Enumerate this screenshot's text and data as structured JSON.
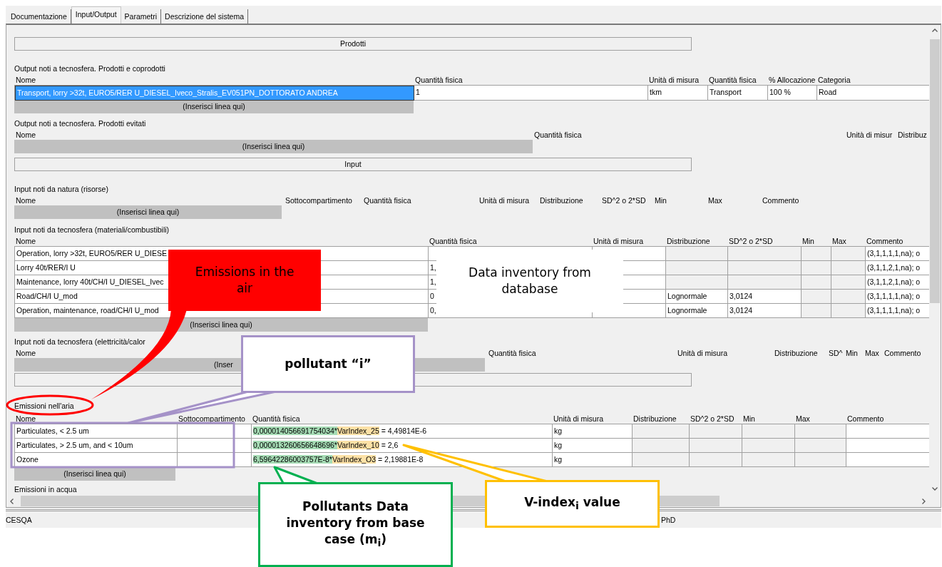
{
  "tabs": [
    {
      "label": "Documentazione",
      "selected": false
    },
    {
      "label": "Input/Output",
      "selected": true
    },
    {
      "label": "Parametri",
      "selected": false
    },
    {
      "label": "Descrizione del sistema",
      "selected": false
    }
  ],
  "sections": [
    {
      "kind": "bar",
      "label": "Prodotti"
    },
    {
      "kind": "table",
      "title": "Output noti a tecnosfera. Prodotti e coprodotti",
      "columns": [
        "Nome",
        "Quantità fisica",
        "Unità di misura",
        "Quantità fisica",
        "% Allocazione",
        "Categoria"
      ],
      "rows": [
        {
          "selected": true,
          "cells": [
            {
              "text": "Transport, lorry >32t, EURO5/RER U_DIESEL_Iveco_Stralis_EV051PN_DOTTORATO ANDREA",
              "disabled": false
            },
            {
              "text": "1",
              "disabled": false
            },
            {
              "text": "tkm",
              "disabled": false
            },
            {
              "text": "Transport",
              "disabled": false
            },
            {
              "text": "100 %",
              "disabled": false
            },
            {
              "text": "Road",
              "disabled": false
            }
          ]
        }
      ],
      "insert": "(Inserisci linea qui)"
    },
    {
      "kind": "table",
      "title": "Output noti a tecnosfera. Prodotti evitati",
      "columns": [
        "Nome",
        "Quantità fisica",
        "Unità di misur",
        "Distribuz"
      ],
      "insert": "(Inserisci linea qui)"
    },
    {
      "kind": "bar",
      "label": "Input"
    },
    {
      "kind": "table",
      "title": "Input noti da natura (risorse)",
      "columns": [
        "Nome",
        "Sottocompartimento",
        "Quantità fisica",
        "Unità di misura",
        "Distribuzione",
        "SD^2 o 2*SD",
        "Min",
        "Max",
        "Commento"
      ],
      "insert": "(Inserisci linea qui)"
    },
    {
      "kind": "table",
      "title": "Input noti da tecnosfera (materiali/combustibili)",
      "columns": [
        "Nome",
        "Quantità fisica",
        "Unità di misura",
        "Distribuzione",
        "SD^2 o 2*SD",
        "Min",
        "Max",
        "Commento"
      ],
      "rows": [
        {
          "selected": false,
          "cells": [
            {
              "text": "Operation, lorry >32t, EURO5/RER U_DIESE",
              "disabled": false
            },
            {
              "disabled": false
            },
            {
              "disabled": false
            },
            {
              "disabled": true
            },
            {
              "disabled": true
            },
            {
              "disabled": true
            },
            {
              "disabled": true
            },
            {
              "text": "(3,1,1,1,1,na); o",
              "disabled": false
            }
          ]
        },
        {
          "selected": false,
          "cells": [
            {
              "text": "Lorry 40t/RER/I U",
              "disabled": false
            },
            {
              "text": "1,",
              "disabled": false
            },
            {
              "disabled": false
            },
            {
              "disabled": true
            },
            {
              "disabled": true
            },
            {
              "disabled": true
            },
            {
              "disabled": true
            },
            {
              "text": "(3,1,1,2,1,na); o",
              "disabled": false
            }
          ]
        },
        {
          "selected": false,
          "cells": [
            {
              "text": "Maintenance, lorry 40t/CH/I U_DIESEL_Ivec",
              "disabled": false
            },
            {
              "text": "1,",
              "disabled": false
            },
            {
              "disabled": false
            },
            {
              "disabled": true
            },
            {
              "disabled": true
            },
            {
              "disabled": true
            },
            {
              "disabled": true
            },
            {
              "text": "(3,1,1,2,1,na); o",
              "disabled": false
            }
          ]
        },
        {
          "selected": false,
          "cells": [
            {
              "text": "Road/CH/I U_mod",
              "disabled": false
            },
            {
              "text": "0",
              "disabled": false
            },
            {
              "disabled": false
            },
            {
              "text": "Lognormale",
              "disabled": false
            },
            {
              "text": "3,0124",
              "disabled": false
            },
            {
              "disabled": true
            },
            {
              "disabled": true
            },
            {
              "text": "(3,1,1,1,1,na); o",
              "disabled": false
            }
          ]
        },
        {
          "selected": false,
          "cells": [
            {
              "text": "Operation, maintenance, road/CH/I U_mod",
              "disabled": false
            },
            {
              "text": "0,",
              "disabled": false
            },
            {
              "disabled": false
            },
            {
              "text": "Lognormale",
              "disabled": false
            },
            {
              "text": "3,0124",
              "disabled": false
            },
            {
              "disabled": true
            },
            {
              "disabled": true
            },
            {
              "text": "(3,1,1,1,1,na); o",
              "disabled": false
            }
          ]
        }
      ],
      "insert": "(Inserisci linea qui)"
    },
    {
      "kind": "table",
      "title": "Input noti da tecnosfera (elettricità/calor",
      "columns": [
        "Nome",
        "Quantità fisica",
        "Unità di misura",
        "Distribuzione",
        "SD^",
        "Min",
        "Max",
        "Commento"
      ],
      "insert": "(Inser"
    },
    {
      "kind": "bar"
    },
    {
      "kind": "table",
      "title": "Emissioni nell'aria",
      "columns": [
        "Nome",
        "Sottocompartimento",
        "Quantità fisica",
        "Unità di misura",
        "Distribuzione",
        "SD^2 o 2*SD",
        "Min",
        "Max",
        "Commento"
      ],
      "rows": [
        {
          "selected": false,
          "cells": [
            {
              "kind": "text",
              "text": "Particulates, < 2.5 um",
              "disabled": false
            },
            {
              "kind": "text",
              "disabled": false
            },
            {
              "kind": "formula",
              "mass": "0,000014056691754034*",
              "index": "VarIndex_25",
              "result": "= 4,49814E-6",
              "disabled": false
            },
            {
              "kind": "text",
              "text": "kg",
              "disabled": false
            },
            {
              "kind": "text",
              "disabled": true
            },
            {
              "kind": "text",
              "disabled": true
            },
            {
              "kind": "text",
              "disabled": true
            },
            {
              "kind": "text",
              "disabled": true
            },
            {
              "kind": "text",
              "disabled": false
            }
          ]
        },
        {
          "selected": false,
          "cells": [
            {
              "kind": "text",
              "text": "Particulates, > 2.5 um, and < 10um",
              "disabled": false
            },
            {
              "kind": "text",
              "disabled": false
            },
            {
              "kind": "formula",
              "mass": "0,000013260656648696*",
              "index": "VarIndex_10",
              "result": "= 2,6",
              "disabled": false
            },
            {
              "kind": "text",
              "text": "kg",
              "disabled": false
            },
            {
              "kind": "text",
              "disabled": true
            },
            {
              "kind": "text",
              "disabled": true
            },
            {
              "kind": "text",
              "disabled": true
            },
            {
              "kind": "text",
              "disabled": true
            },
            {
              "kind": "text",
              "disabled": false
            }
          ]
        },
        {
          "selected": false,
          "cells": [
            {
              "kind": "text",
              "text": "Ozone",
              "disabled": false
            },
            {
              "kind": "text",
              "disabled": false
            },
            {
              "kind": "formula",
              "mass": "6,59642286003757E-8*",
              "index": "VarIndex_O3",
              "result": "= 2,19881E-8",
              "disabled": false
            },
            {
              "kind": "text",
              "text": "kg",
              "disabled": false
            },
            {
              "kind": "text",
              "disabled": true
            },
            {
              "kind": "text",
              "disabled": true
            },
            {
              "kind": "text",
              "disabled": true
            },
            {
              "kind": "text",
              "disabled": true
            },
            {
              "kind": "text",
              "disabled": false
            }
          ]
        }
      ],
      "insert": "(Inserisci linea qui)"
    },
    {
      "kind": "label",
      "title": "Emissioni in acqua"
    }
  ],
  "status_bar": {
    "left": "CESQA",
    "right": "PhD"
  },
  "callouts": [
    {
      "kind": "filled",
      "color": "#ff0000",
      "text": "Emissions in the air"
    },
    {
      "kind": "filled",
      "color": "#ffffff",
      "text": "Data inventory from database"
    },
    {
      "kind": "outlined",
      "color": "#a592c8",
      "text": "pollutant “i”"
    },
    {
      "kind": "outlined",
      "color": "#00b050",
      "text": "Pollutants Data inventory from base case (m$_{i}$)"
    },
    {
      "kind": "outlined",
      "color": "#ffc000",
      "text": "V-index$_{i}$ value"
    }
  ]
}
